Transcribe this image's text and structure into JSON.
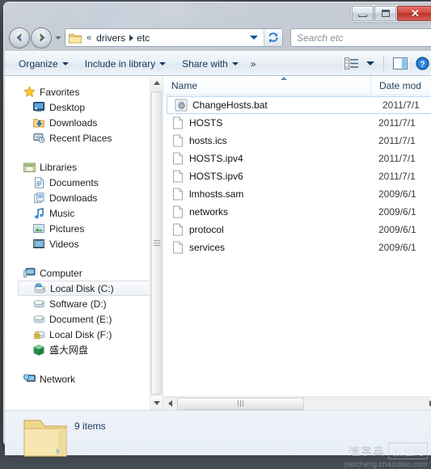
{
  "window": {
    "titlebar_buttons": [
      {
        "name": "minimize",
        "label": "",
        "icon": "minimize-icon"
      },
      {
        "name": "maximize",
        "label": "",
        "icon": "maximize-icon"
      },
      {
        "name": "close",
        "label": "✕",
        "icon": "close-icon"
      }
    ]
  },
  "addressbar": {
    "back_icon": "back-arrow-icon",
    "forward_icon": "forward-arrow-icon",
    "history_caret_icon": "chevron-down-icon",
    "folder_icon": "folder-icon",
    "overflow_chevrons": "«",
    "crumbs": [
      "drivers",
      "etc"
    ],
    "dropdown_icon": "chevron-down-icon",
    "refresh_icon": "refresh-icon"
  },
  "search": {
    "placeholder": "Search etc",
    "value": "",
    "icon": "search-icon"
  },
  "commandbar": {
    "items": [
      {
        "label": "Organize",
        "has_caret": true
      },
      {
        "label": "Include in library",
        "has_caret": true
      },
      {
        "label": "Share with",
        "has_caret": true
      }
    ],
    "overflow_label": "»",
    "view_icon": "view-list-icon",
    "view_caret_icon": "chevron-down-icon",
    "preview_icon": "preview-pane-icon",
    "help_icon": "help-icon"
  },
  "navpane": {
    "groups": [
      {
        "header": {
          "label": "Favorites",
          "icon": "star-icon"
        },
        "items": [
          {
            "label": "Desktop",
            "icon": "desktop-icon",
            "selected": false
          },
          {
            "label": "Downloads",
            "icon": "downloads-icon",
            "selected": false
          },
          {
            "label": "Recent Places",
            "icon": "recent-places-icon",
            "selected": false
          }
        ]
      },
      {
        "header": {
          "label": "Libraries",
          "icon": "libraries-icon"
        },
        "items": [
          {
            "label": "Documents",
            "icon": "documents-library-icon",
            "selected": false
          },
          {
            "label": "Downloads",
            "icon": "downloads-library-icon",
            "selected": false
          },
          {
            "label": "Music",
            "icon": "music-library-icon",
            "selected": false
          },
          {
            "label": "Pictures",
            "icon": "pictures-library-icon",
            "selected": false
          },
          {
            "label": "Videos",
            "icon": "videos-library-icon",
            "selected": false
          }
        ]
      },
      {
        "header": {
          "label": "Computer",
          "icon": "computer-icon"
        },
        "items": [
          {
            "label": "Local Disk (C:)",
            "icon": "system-drive-icon",
            "selected": true
          },
          {
            "label": "Software (D:)",
            "icon": "drive-icon",
            "selected": false
          },
          {
            "label": "Document (E:)",
            "icon": "drive-icon",
            "selected": false
          },
          {
            "label": "Local Disk (F:)",
            "icon": "locked-drive-icon",
            "selected": false
          },
          {
            "label": "盛大网盘",
            "icon": "cloud-drive-icon",
            "selected": false
          }
        ]
      },
      {
        "header": {
          "label": "Network",
          "icon": "network-icon"
        },
        "items": []
      }
    ],
    "scrollbar": {
      "up_icon": "scroll-up-icon",
      "down_icon": "scroll-down-icon"
    }
  },
  "filelist": {
    "columns": [
      {
        "key": "name",
        "label": "Name",
        "sorted": "asc"
      },
      {
        "key": "date",
        "label": "Date mod",
        "sorted": null
      }
    ],
    "rows": [
      {
        "name": "ChangeHosts.bat",
        "date": "2011/7/1",
        "icon": "bat-script-icon",
        "selected": true
      },
      {
        "name": "HOSTS",
        "date": "2011/7/1",
        "icon": "generic-file-icon",
        "selected": false
      },
      {
        "name": "hosts.ics",
        "date": "2011/7/1",
        "icon": "generic-file-icon",
        "selected": false
      },
      {
        "name": "HOSTS.ipv4",
        "date": "2011/7/1",
        "icon": "generic-file-icon",
        "selected": false
      },
      {
        "name": "HOSTS.ipv6",
        "date": "2011/7/1",
        "icon": "generic-file-icon",
        "selected": false
      },
      {
        "name": "lmhosts.sam",
        "date": "2009/6/1",
        "icon": "generic-file-icon",
        "selected": false
      },
      {
        "name": "networks",
        "date": "2009/6/1",
        "icon": "generic-file-icon",
        "selected": false
      },
      {
        "name": "protocol",
        "date": "2009/6/1",
        "icon": "generic-file-icon",
        "selected": false
      },
      {
        "name": "services",
        "date": "2009/6/1",
        "icon": "generic-file-icon",
        "selected": false
      }
    ],
    "hscrollbar": {
      "left_icon": "scroll-left-icon",
      "right_icon": "scroll-right-icon"
    }
  },
  "statusbar": {
    "folder_icon": "folder-large-icon",
    "item_count_text": "9 items"
  },
  "watermark": {
    "cn_left": "造字典",
    "cn_right": "教程网",
    "url": "jiaocheng.chazidian.com"
  },
  "colors": {
    "accent": "#15539e",
    "command_text": "#17375e",
    "close_button": "#c0392b",
    "selection_border": "#b9d2ee"
  }
}
